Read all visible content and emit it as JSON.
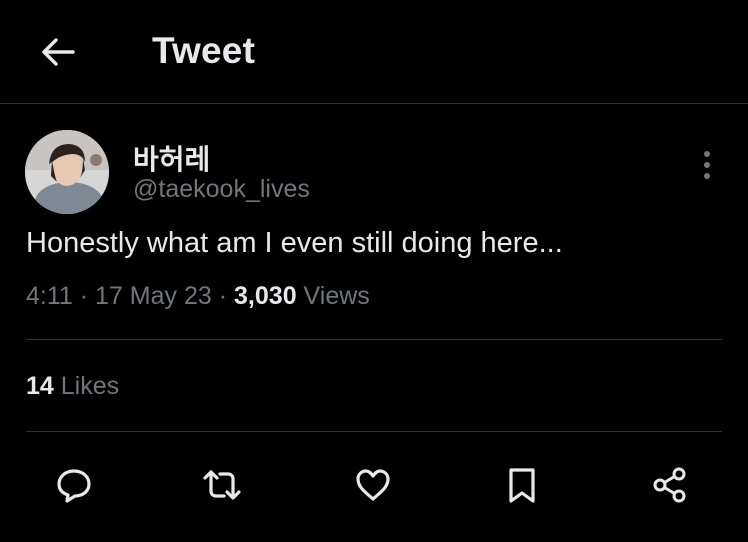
{
  "header": {
    "title": "Tweet",
    "back_icon": "arrow-left-icon"
  },
  "tweet": {
    "author": {
      "display_name": "바허레",
      "handle": "@taekook_lives"
    },
    "text": "Honestly what am I even still doing here...",
    "time": "4:11",
    "date": "17 May 23",
    "separator": "·",
    "views_count": "3,030",
    "views_label": "Views"
  },
  "engagement": {
    "likes_count": "14",
    "likes_label": "Likes"
  },
  "actions": [
    {
      "name": "reply",
      "icon": "reply-icon"
    },
    {
      "name": "retweet",
      "icon": "retweet-icon"
    },
    {
      "name": "like",
      "icon": "heart-icon"
    },
    {
      "name": "bookmark",
      "icon": "bookmark-icon"
    },
    {
      "name": "share",
      "icon": "share-icon"
    }
  ],
  "colors": {
    "background": "#000000",
    "primary_text": "#e7e9ea",
    "secondary_text": "#71767b",
    "divider": "#2f3336"
  }
}
